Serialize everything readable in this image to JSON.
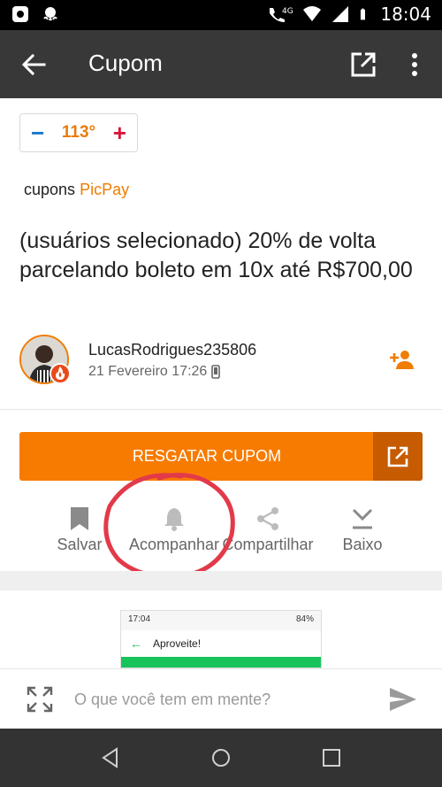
{
  "status_bar": {
    "time": "18:04",
    "network": "4G",
    "icons": [
      "app-notification-icon",
      "octopus-app-icon",
      "wifi-call-icon",
      "wifi-icon",
      "signal-icon",
      "battery-icon"
    ]
  },
  "app_bar": {
    "title": "Cupom",
    "icons": [
      "back-arrow-icon",
      "open-external-icon",
      "more-vert-icon"
    ]
  },
  "temperature": {
    "value": "113°",
    "minus": "−",
    "plus": "+"
  },
  "category": {
    "prefix": "cupons",
    "brand": "PicPay"
  },
  "deal": {
    "title": "(usuários selecionado) 20% de volta parcelando boleto em 10x até R$700,00"
  },
  "author": {
    "name": "LucasRodrigues235806",
    "date": "21 Fevereiro 17:26"
  },
  "cta": {
    "label": "RESGATAR CUPOM"
  },
  "actions": [
    {
      "label": "Salvar",
      "icon": "bookmark-icon"
    },
    {
      "label": "Acompanhar",
      "icon": "bell-icon"
    },
    {
      "label": "Compartilhar",
      "icon": "share-icon"
    },
    {
      "label": "Baixo",
      "icon": "download-icon"
    }
  ],
  "embedded_screenshot": {
    "time": "17:04",
    "battery": "84%",
    "title": "Aproveite!"
  },
  "comment": {
    "placeholder": "O que você tem em mente?"
  },
  "colors": {
    "accent_orange": "#f77b00",
    "brand_orange": "#f07c00",
    "hot_temperature": "#e87b0c",
    "app_bar": "#383838",
    "annotation_red": "#e23a4a"
  }
}
